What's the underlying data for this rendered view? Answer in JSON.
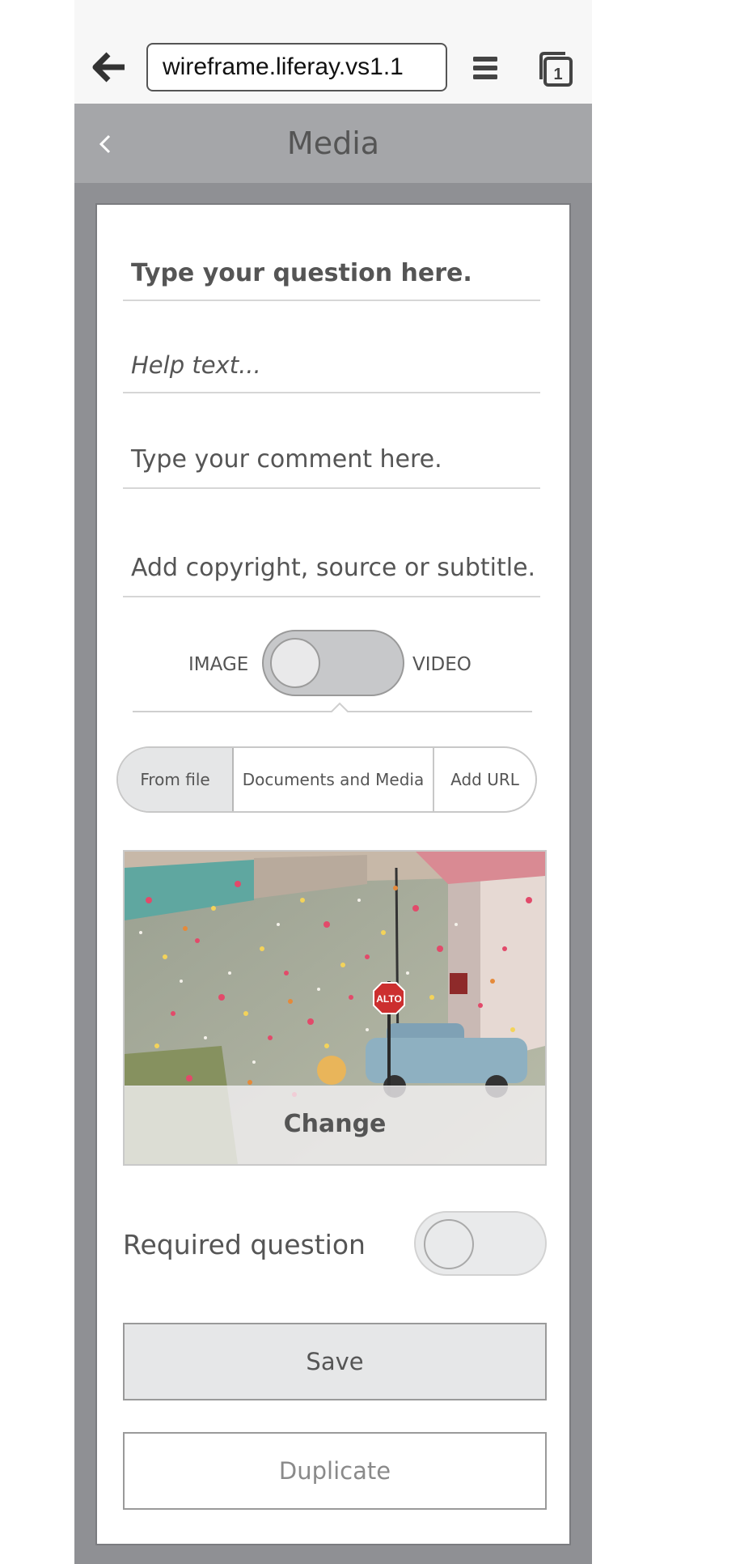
{
  "browser": {
    "url": "wireframe.liferay.vs1.1",
    "tab_count": "1"
  },
  "header": {
    "title": "Media"
  },
  "form": {
    "question_placeholder": "Type your question here.",
    "help_placeholder": "Help text...",
    "comment_placeholder": "Type your comment here.",
    "copyright_placeholder": "Add copyright, source or subtitle."
  },
  "media_type": {
    "left_label": "IMAGE",
    "right_label": "VIDEO",
    "selected": "IMAGE"
  },
  "source_tabs": [
    {
      "label": "From file",
      "selected": true
    },
    {
      "label": "Documents and Media",
      "selected": false
    },
    {
      "label": "Add URL",
      "selected": false
    }
  ],
  "image": {
    "sign_text": "ALTO",
    "change_label": "Change"
  },
  "required": {
    "label": "Required question",
    "enabled": false
  },
  "buttons": {
    "save": "Save",
    "duplicate": "Duplicate"
  }
}
